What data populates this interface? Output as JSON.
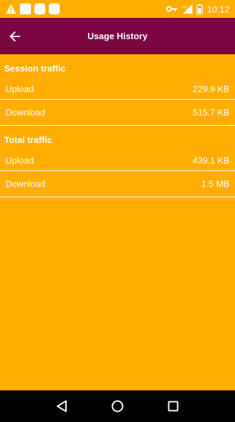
{
  "status_bar": {
    "time": "10:12",
    "network": "4G",
    "icons": [
      "warning-icon",
      "notification-icon",
      "notification-icon",
      "notification-icon",
      "vpn-key-icon",
      "signal-icon",
      "battery-icon"
    ]
  },
  "app_bar": {
    "title": "Usage History",
    "back_icon": "arrow-back-icon"
  },
  "sections": [
    {
      "title": "Session traffic",
      "rows": [
        {
          "label": "Upload",
          "value": "229.9 KB"
        },
        {
          "label": "Download",
          "value": "515.7 KB"
        }
      ]
    },
    {
      "title": "Total traffic",
      "rows": [
        {
          "label": "Upload",
          "value": "439.1 KB"
        },
        {
          "label": "Download",
          "value": "1.5 MB"
        }
      ]
    }
  ],
  "nav_bar": {
    "buttons": [
      "back-triangle-icon",
      "home-circle-icon",
      "recents-square-icon"
    ]
  },
  "colors": {
    "background": "#FFAE00",
    "app_bar": "#7A0540",
    "text": "#FFFFFF"
  }
}
